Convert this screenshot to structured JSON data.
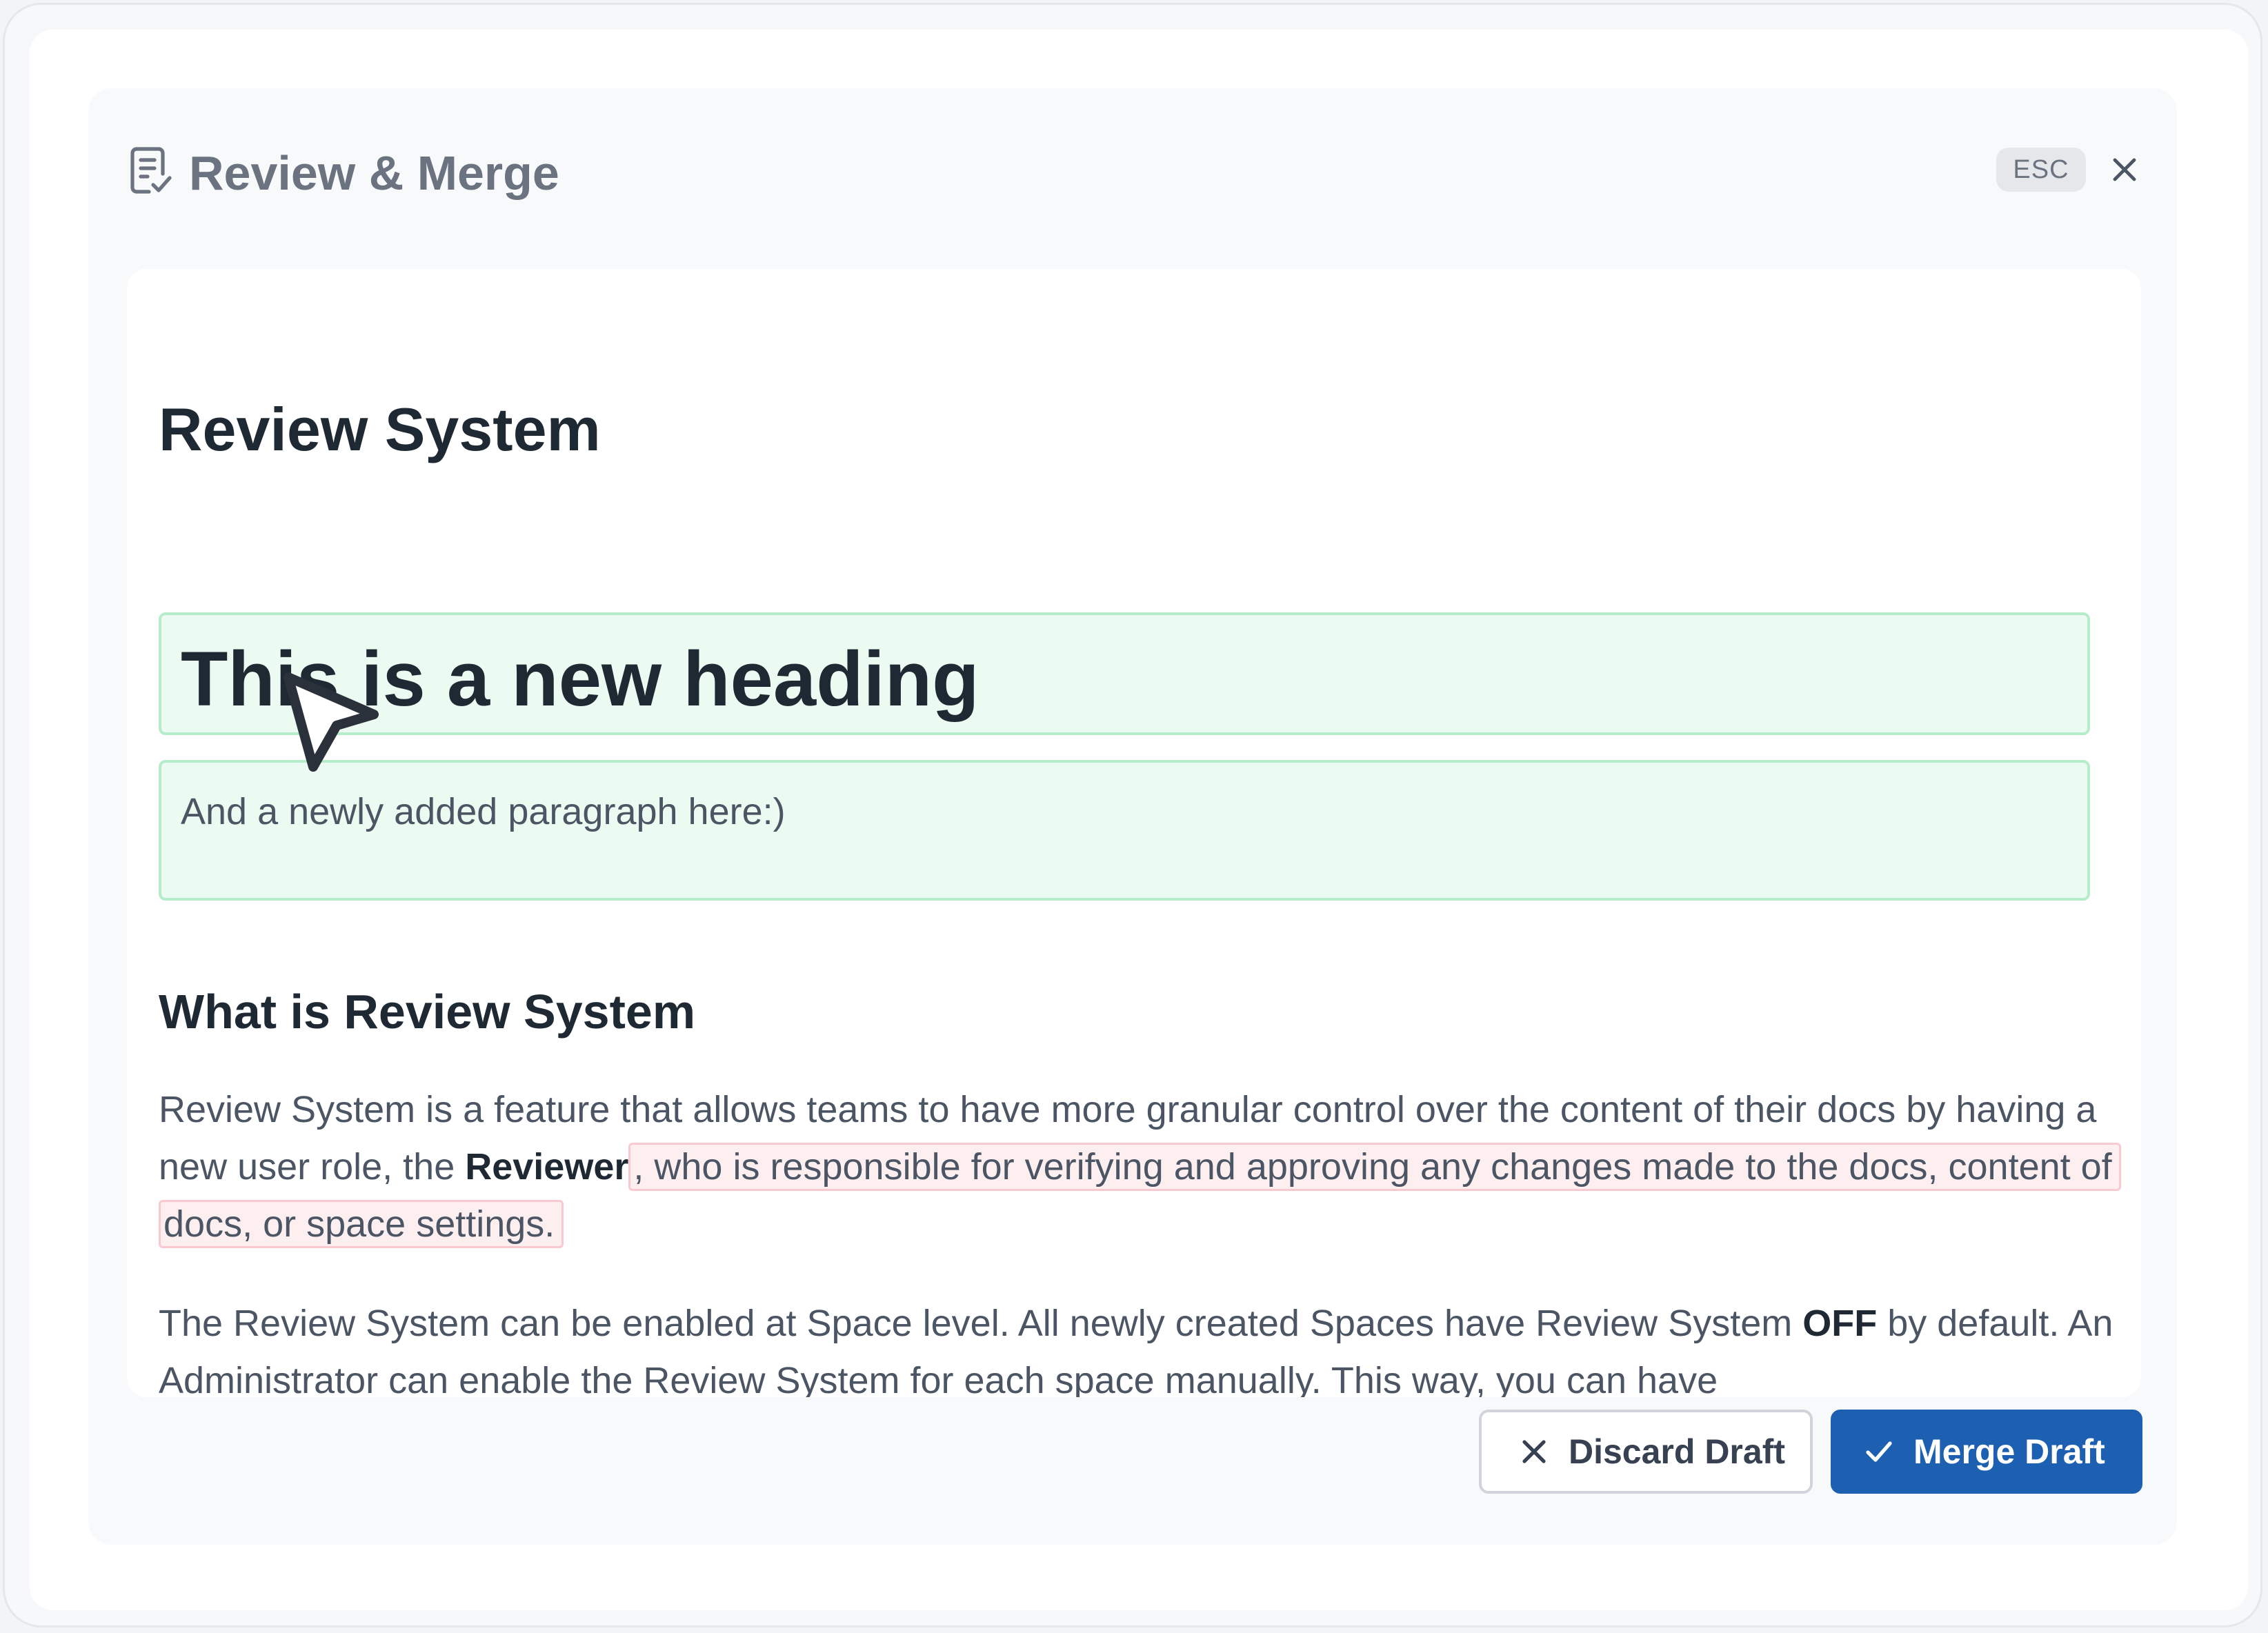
{
  "modal": {
    "title": "Review & Merge",
    "esc_label": "ESC",
    "icons": {
      "title": "document-check-icon",
      "close": "close-icon"
    }
  },
  "document": {
    "title": "Review System",
    "added_heading": "This is a new heading",
    "added_paragraph": "And a newly added paragraph here:)",
    "section_heading": "What is Review System",
    "para1": {
      "before": "Review System is a feature that allows teams to have more granular control over the content of their docs by having a new user role, the ",
      "bold": "Reviewer",
      "removed": ", who is responsible for verifying and approving any changes made to the docs, content of docs, or space settings."
    },
    "para2": {
      "before": "The Review System can be enabled at Space level. All newly created Spaces have Review System ",
      "bold": "OFF",
      "after": " by default. An Administrator can enable the Review System for each space manually. This way, you can have"
    }
  },
  "footer": {
    "discard_label": "Discard Draft",
    "merge_label": "Merge Draft",
    "icons": {
      "discard": "x-icon",
      "merge": "check-icon"
    }
  },
  "colors": {
    "added_bg": "#ebfbf1",
    "added_border": "#b7ecca",
    "removed_bg": "#fdeef0",
    "removed_border": "#f9c9cf",
    "primary": "#1d5fb0"
  }
}
